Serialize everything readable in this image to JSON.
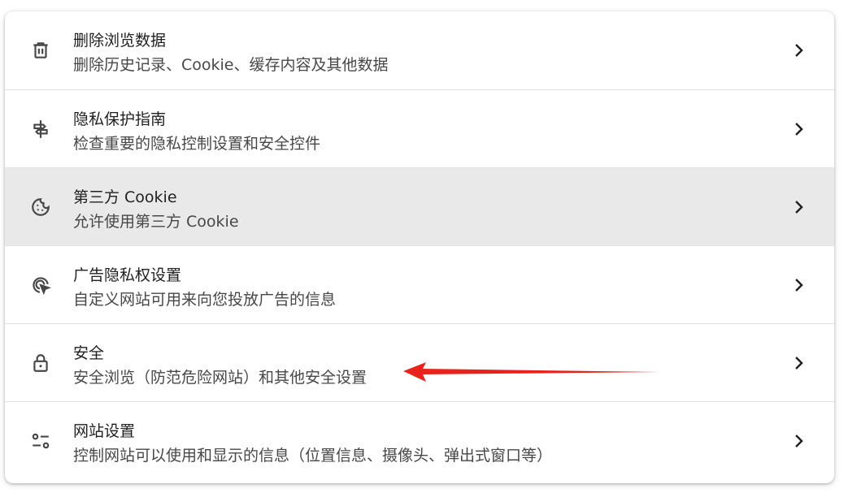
{
  "colors": {
    "accent_arrow": "#e8231c",
    "highlight_row": "#e9e9e9",
    "icon": "#474747"
  },
  "rows": [
    {
      "icon": "trash-icon",
      "title": "删除浏览数据",
      "subtitle": "删除历史记录、Cookie、缓存内容及其他数据"
    },
    {
      "icon": "privacy-guide-icon",
      "title": "隐私保护指南",
      "subtitle": "检查重要的隐私控制设置和安全控件"
    },
    {
      "icon": "cookie-icon",
      "title": "第三方 Cookie",
      "subtitle": "允许使用第三方 Cookie",
      "highlighted": true
    },
    {
      "icon": "ad-privacy-icon",
      "title": "广告隐私权设置",
      "subtitle": "自定义网站可用来向您投放广告的信息"
    },
    {
      "icon": "lock-icon",
      "title": "安全",
      "subtitle": "安全浏览（防范危险网站）和其他安全设置"
    },
    {
      "icon": "site-settings-icon",
      "title": "网站设置",
      "subtitle": "控制网站可以使用和显示的信息（位置信息、摄像头、弹出式窗口等）"
    }
  ]
}
